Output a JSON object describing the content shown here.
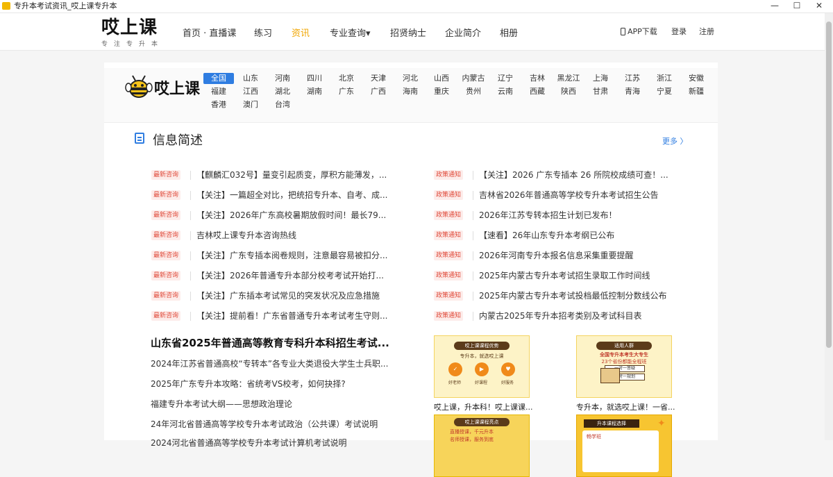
{
  "window": {
    "title": "专升本考试资讯_哎上课专升本",
    "minimize": "—",
    "maximize": "☐",
    "close": "✕"
  },
  "header": {
    "logo_text": "哎上课",
    "logo_sub": "专注专升本",
    "nav": [
      "首页 · 直播课",
      "练习",
      "资讯",
      "专业查询▾",
      "招贤纳士",
      "企业简介",
      "相册"
    ],
    "app_download": "APP下载",
    "login": "登录",
    "register": "注册",
    "accent_color": "#f0a500"
  },
  "region_bar": {
    "logo_text": "哎上课",
    "rows": [
      [
        "全国",
        "山东",
        "河南",
        "四川",
        "北京",
        "天津",
        "河北",
        "山西",
        "内蒙古",
        "辽宁",
        "吉林",
        "黑龙江",
        "上海",
        "江苏",
        "浙江",
        "安徽"
      ],
      [
        "福建",
        "江西",
        "湖北",
        "湖南",
        "广东",
        "广西",
        "海南",
        "重庆",
        "贵州",
        "云南",
        "西藏",
        "陕西",
        "甘肃",
        "青海",
        "宁夏",
        "新疆"
      ],
      [
        "香港",
        "澳门",
        "台湾"
      ]
    ],
    "selected": "全国",
    "selected_color": "#2f7de1"
  },
  "section": {
    "title": "信息简述",
    "more": "更多 〉"
  },
  "news_left": [
    {
      "tag": "最新咨询",
      "text": "【麒麟汇032号】量变引起质变，厚积方能薄发，..."
    },
    {
      "tag": "最新咨询",
      "text": "【关注】一篇超全对比，把统招专升本、自考、成..."
    },
    {
      "tag": "最新咨询",
      "text": "【关注】2026年广东高校暑期放假时间！最长79..."
    },
    {
      "tag": "最新咨询",
      "text": "吉林哎上课专升本咨询热线"
    },
    {
      "tag": "最新咨询",
      "text": "【关注】广东专插本阅卷规则，注意最容易被扣分..."
    },
    {
      "tag": "最新咨询",
      "text": "【关注】2026年普通专升本部分校考考试开始打..."
    },
    {
      "tag": "最新咨询",
      "text": "【关注】广东插本考试常见的突发状况及应急措施"
    },
    {
      "tag": "最新咨询",
      "text": "【关注】提前看！广东省普通专升本考试考生守则..."
    }
  ],
  "news_right": [
    {
      "tag": "政策通知",
      "text": "【关注】2026 广东专插本 26 所院校成绩可查！..."
    },
    {
      "tag": "政策通知",
      "text": "吉林省2026年普通高等学校专升本考试招生公告"
    },
    {
      "tag": "政策通知",
      "text": "2026年江苏专转本招生计划已发布！"
    },
    {
      "tag": "政策通知",
      "text": "【速看】26年山东专升本考纲已公布"
    },
    {
      "tag": "政策通知",
      "text": "2026年河南专升本报名信息采集重要提醒"
    },
    {
      "tag": "政策通知",
      "text": "2025年内蒙古专升本考试招生录取工作时间线"
    },
    {
      "tag": "政策通知",
      "text": "2025年内蒙古专升本考试投档最低控制分数线公布"
    },
    {
      "tag": "政策通知",
      "text": "内蒙古2025年专升本招考类别及考试科目表"
    }
  ],
  "articles": {
    "headline": "山东省2025年普通高等教育专科升本科招生考试...",
    "items": [
      "2024年江苏省普通高校“专转本”各专业大类退役大学生士兵职...",
      "2025年广东专升本攻略：省统考VS校考，如何抉择?",
      "福建专升本考试大纲——思想政治理论",
      "24年河北省普通高等学校专升本考试政治（公共课）考试说明",
      "2024河北省普通高等学校专升本考试计算机考试说明"
    ]
  },
  "promo": {
    "card1": {
      "banner": "哎上课课程优势",
      "sub": "专升本，就选哎上课",
      "labels": [
        "好老师",
        "好课程",
        "好服务"
      ],
      "caption": "哎上课，升本科！哎上课课..."
    },
    "card2": {
      "banner": "适用人群",
      "red": "全国专升本考生大专生",
      "sub2": "23个省份都能全程班",
      "lines": [
        "一对一答疑",
        "一对一规划"
      ],
      "caption": "专升本，就选哎上课！一省..."
    },
    "card3": {
      "banner": "哎上课课程亮点",
      "lines": [
        "直播授课，千元升本",
        "名师授课，服务到底"
      ]
    },
    "card4": {
      "banner": "升本课程选择",
      "inner": "畅学班"
    }
  }
}
